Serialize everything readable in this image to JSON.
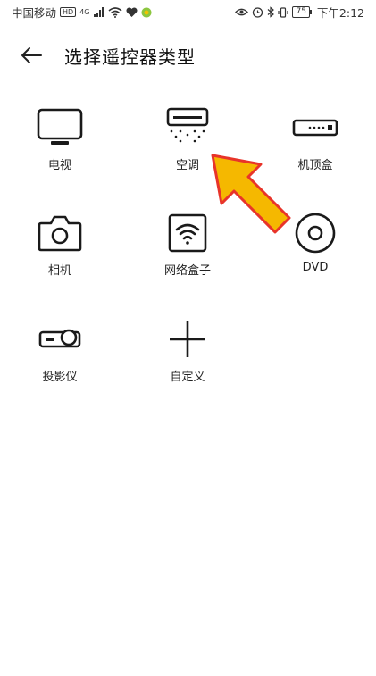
{
  "status_bar": {
    "carrier": "中国移动",
    "hd": "HD",
    "network": "4G",
    "battery": "75",
    "time": "下午2:12"
  },
  "header": {
    "title": "选择遥控器类型",
    "back_icon": "back-arrow-icon"
  },
  "devices": [
    {
      "label": "电视",
      "icon": "tv-icon"
    },
    {
      "label": "空调",
      "icon": "air-conditioner-icon"
    },
    {
      "label": "机顶盒",
      "icon": "set-top-box-icon"
    },
    {
      "label": "相机",
      "icon": "camera-icon"
    },
    {
      "label": "网络盒子",
      "icon": "network-box-icon"
    },
    {
      "label": "DVD",
      "icon": "dvd-icon"
    },
    {
      "label": "投影仪",
      "icon": "projector-icon"
    },
    {
      "label": "自定义",
      "icon": "plus-icon"
    }
  ],
  "annotation": {
    "arrow_color": "#f5b800",
    "arrow_border": "#e8342a"
  }
}
